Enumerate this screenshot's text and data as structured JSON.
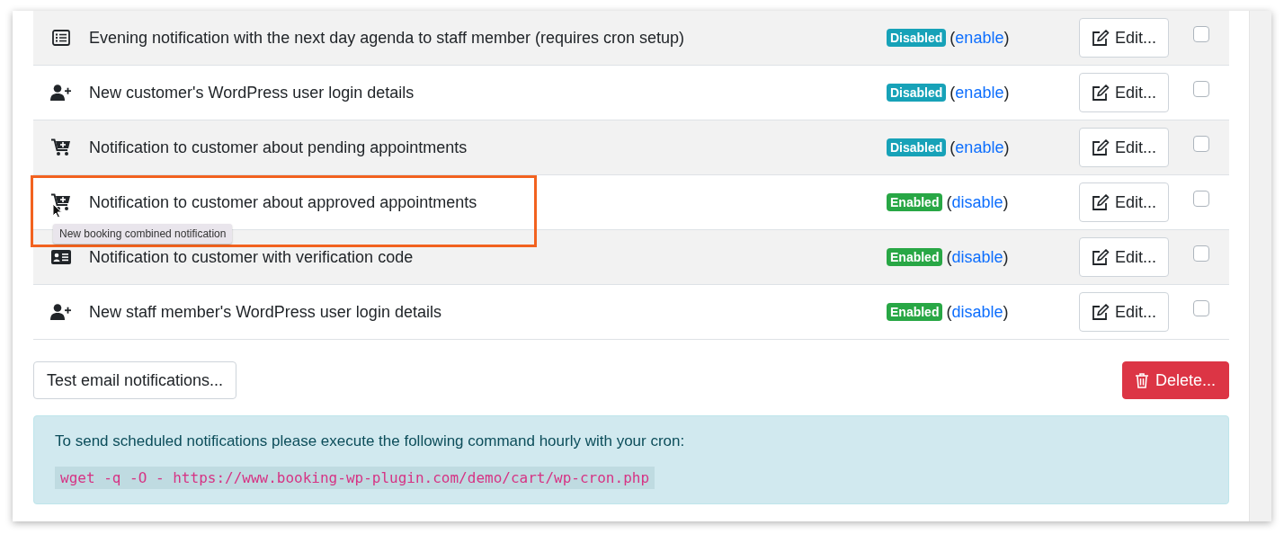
{
  "notifications": [
    {
      "kind": "list",
      "title": "Evening notification with the next day agenda to staff member (requires cron setup)",
      "enabled": false,
      "status": "Disabled",
      "toggle": {
        "before": "(",
        "link": "enable",
        "after": ")"
      },
      "edit_button": "Edit...",
      "checked": false,
      "highlighted": false
    },
    {
      "kind": "user-plus",
      "title": "New customer's WordPress user login details",
      "enabled": false,
      "status": "Disabled",
      "toggle": {
        "before": "(",
        "link": "enable",
        "after": ")"
      },
      "edit_button": "Edit...",
      "checked": false,
      "highlighted": false
    },
    {
      "kind": "cart",
      "title": "Notification to customer about pending appointments",
      "enabled": false,
      "status": "Disabled",
      "toggle": {
        "before": "(",
        "link": "enable",
        "after": ")"
      },
      "edit_button": "Edit...",
      "checked": false,
      "highlighted": false
    },
    {
      "kind": "cart",
      "title": "Notification to customer about approved appointments",
      "enabled": true,
      "status": "Enabled",
      "toggle": {
        "before": "(",
        "link": "disable",
        "after": ")"
      },
      "edit_button": "Edit...",
      "checked": false,
      "highlighted": true,
      "tooltip": "New booking combined notification"
    },
    {
      "kind": "id-card",
      "title": "Notification to customer with verification code",
      "enabled": true,
      "status": "Enabled",
      "toggle": {
        "before": "(",
        "link": "disable",
        "after": ")"
      },
      "edit_button": "Edit...",
      "checked": false,
      "highlighted": false
    },
    {
      "kind": "user-plus",
      "title": "New staff member's WordPress user login details",
      "enabled": true,
      "status": "Enabled",
      "toggle": {
        "before": "(",
        "link": "disable",
        "after": ")"
      },
      "edit_button": "Edit...",
      "checked": false,
      "highlighted": false
    }
  ],
  "test_button": "Test email notifications...",
  "delete_button": "Delete...",
  "alert": {
    "text": "To send scheduled notifications please execute the following command hourly with your cron:",
    "command": "wget -q -O - https://www.booking-wp-plugin.com/demo/cart/wp-cron.php"
  }
}
